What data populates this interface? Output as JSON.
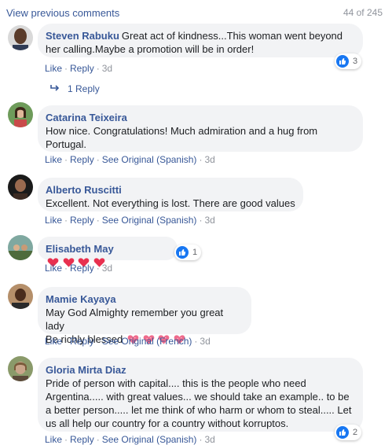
{
  "header": {
    "view_previous": "View previous comments",
    "count": "44 of 245"
  },
  "actions": {
    "like": "Like",
    "reply": "Reply",
    "dot": "·"
  },
  "comments": [
    {
      "author": "Steven Rabuku",
      "text": "Great act of kindness...This woman went beyond her calling.Maybe a promotion will be in order!",
      "time": "3d",
      "see_original": "",
      "reactions": "3",
      "reply_count": "1 Reply"
    },
    {
      "author": "Catarina Teixeira",
      "text": "How nice. Congratulations! Much admiration and a hug from Portugal.",
      "time": "3d",
      "see_original": "See Original (Spanish)"
    },
    {
      "author": "Alberto Ruscitti",
      "text": "Excellent. Not everything is lost. There are good values",
      "time": "3d",
      "see_original": "See Original (Spanish)"
    },
    {
      "author": "Elisabeth May",
      "text": "",
      "time": "3d",
      "reactions": "1",
      "heart_emoji": "red-heart-emoji"
    },
    {
      "author": "Mamie Kayaya",
      "line1": "May God Almighty remember you great lady",
      "line2": "Be richly blessed",
      "time": "3d",
      "see_original": "See Original (French)",
      "heart_emoji": "sparkling-heart-emoji"
    },
    {
      "author": "Gloria Mirta Diaz",
      "text": "Pride of person with capital.... this is the people who need Argentina..... with great values... we should take an example.. to be a better person..... let me think of who harm or whom to steal..... Let us all help our country for a country without korruptos.",
      "time": "3d",
      "see_original": "See Original (Spanish)",
      "reactions": "2"
    }
  ],
  "colors": {
    "link": "#385898",
    "bubble": "#f2f3f5",
    "meta": "#90949c",
    "like_blue": "#1877f2",
    "heart_red": "#e8304f",
    "heart_pink": "#ef6b8c"
  }
}
